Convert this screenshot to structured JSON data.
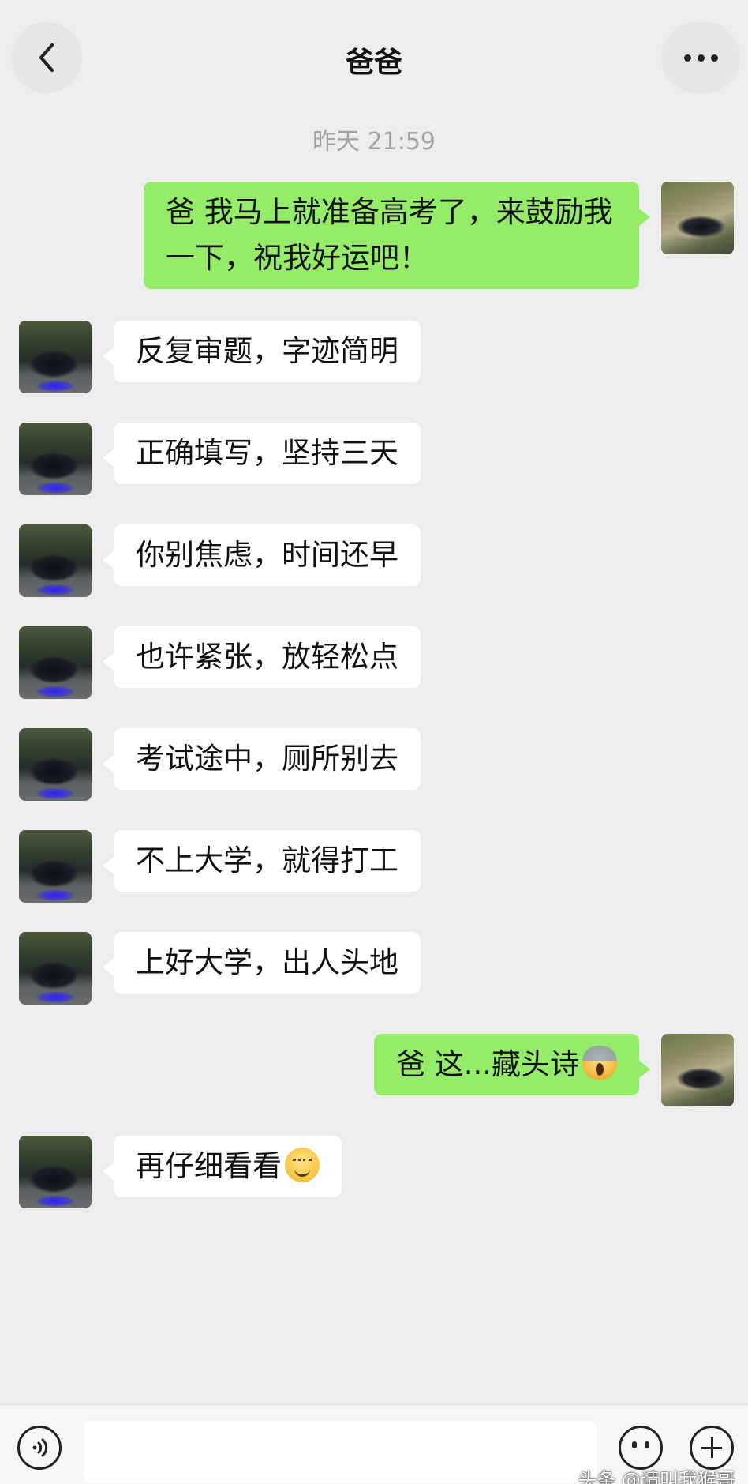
{
  "header": {
    "title": "爸爸",
    "back_icon": "chevron-left-icon",
    "more_icon": "more-dots-icon"
  },
  "timestamp": "昨天 21:59",
  "messages": [
    {
      "from": "me",
      "lines": [
        "爸 我马上就准备高考了，来鼓励我",
        "一下，祝我好运吧！"
      ]
    },
    {
      "from": "dad",
      "text": "反复审题，字迹简明"
    },
    {
      "from": "dad",
      "text": "正确填写，坚持三天"
    },
    {
      "from": "dad",
      "text": "你别焦虑，时间还早"
    },
    {
      "from": "dad",
      "text": "也许紧张，放轻松点"
    },
    {
      "from": "dad",
      "text": "考试途中，厕所别去"
    },
    {
      "from": "dad",
      "text": "不上大学，就得打工"
    },
    {
      "from": "dad",
      "text": "上好大学，出人头地"
    },
    {
      "from": "me",
      "text": "爸 这...藏头诗",
      "emoji": "screaming-face-emoji"
    },
    {
      "from": "dad",
      "text": "再仔细看看",
      "emoji": "smiling-face-emoji"
    }
  ],
  "input_bar": {
    "voice_icon": "voice-icon",
    "emoji_icon": "emoji-face-icon",
    "plus_icon": "plus-icon",
    "input_value": ""
  },
  "watermark": "头条 @请叫我猴哥",
  "colors": {
    "background": "#ededed",
    "my_bubble": "#95ec69",
    "their_bubble": "#ffffff"
  }
}
